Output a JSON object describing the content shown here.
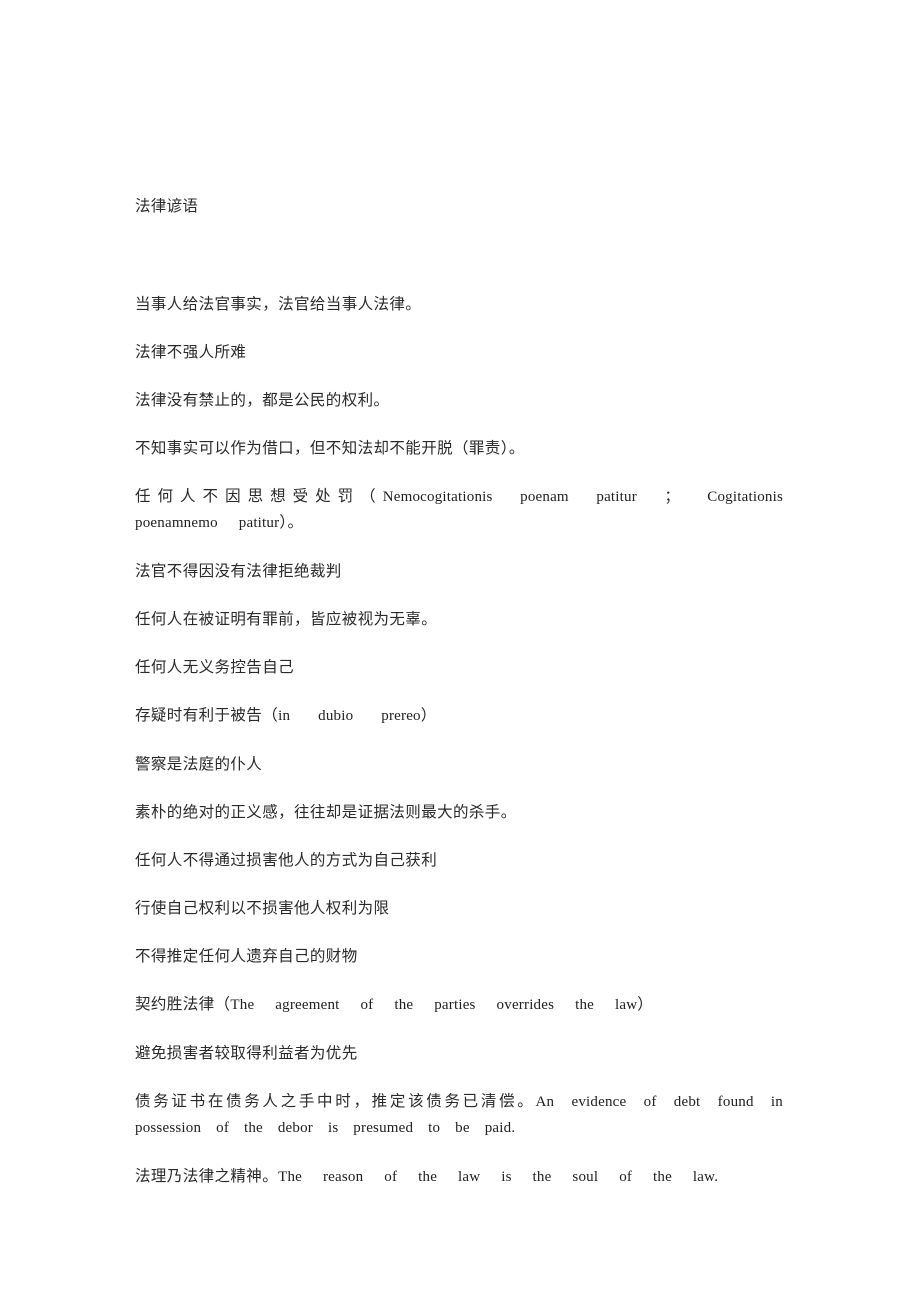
{
  "document": {
    "title": "法律谚语",
    "page_background": "#ffffff",
    "text_color": "#222222",
    "paragraphs": [
      {
        "id": "p1",
        "zh": "当事人给法官事实，法官给当事人法律。",
        "latin": ""
      },
      {
        "id": "p2",
        "zh": "法律不强人所难",
        "latin": ""
      },
      {
        "id": "p3",
        "zh": "法律没有禁止的，都是公民的权利。",
        "latin": ""
      },
      {
        "id": "p4",
        "zh": "不知事实可以作为借口，但不知法却不能开脱（罪责）。",
        "latin": ""
      },
      {
        "id": "p5",
        "zh": "任何人不因思想受处罚（",
        "latin": "Nemocogitationis poenam patitur ； Cogitationis poenamnemo patitur",
        "zh_tail": "）。"
      },
      {
        "id": "p6",
        "zh": "法官不得因没有法律拒绝裁判",
        "latin": ""
      },
      {
        "id": "p7",
        "zh": "任何人在被证明有罪前，皆应被视为无辜。",
        "latin": ""
      },
      {
        "id": "p8",
        "zh": "任何人无义务控告自己",
        "latin": ""
      },
      {
        "id": "p9",
        "zh": "存疑时有利于被告（",
        "latin": "in dubio prereo",
        "zh_tail": "）"
      },
      {
        "id": "p10",
        "zh": "警察是法庭的仆人",
        "latin": ""
      },
      {
        "id": "p11",
        "zh": "素朴的绝对的正义感，往往却是证据法则最大的杀手。",
        "latin": ""
      },
      {
        "id": "p12",
        "zh": "任何人不得通过损害他人的方式为自己获利",
        "latin": ""
      },
      {
        "id": "p13",
        "zh": "行使自己权利以不损害他人权利为限",
        "latin": ""
      },
      {
        "id": "p14",
        "zh": "不得推定任何人遗弃自己的财物",
        "latin": ""
      },
      {
        "id": "p15",
        "zh": "契约胜法律（",
        "latin": "The agreement of the parties overrides the law",
        "zh_tail": "）"
      },
      {
        "id": "p16",
        "zh": "避免损害者较取得利益者为优先",
        "latin": ""
      },
      {
        "id": "p17",
        "zh": "债务证书在债务人之手中时，推定该债务已清偿。",
        "latin": "An evidence of debt found in possession of the debor is presumed to be paid.",
        "zh_tail": ""
      },
      {
        "id": "p18",
        "zh": "法理乃法律之精神。",
        "latin": "The reason of the law is the soul of the law.",
        "zh_tail": ""
      }
    ]
  }
}
